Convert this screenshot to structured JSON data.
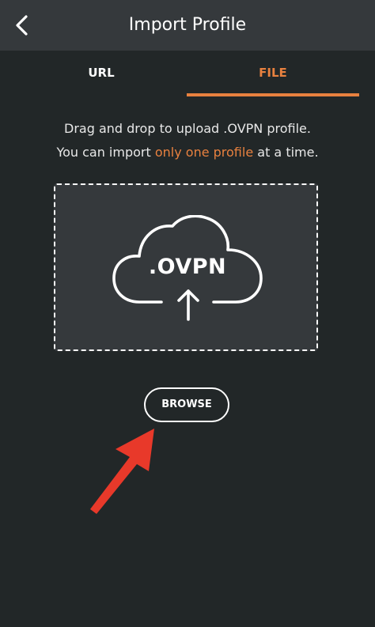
{
  "header": {
    "title": "Import Profile",
    "back_icon": "chevron-left-icon"
  },
  "tabs": [
    {
      "label": "URL",
      "active": false
    },
    {
      "label": "FILE",
      "active": true
    }
  ],
  "instructions": {
    "line1": "Drag and drop to upload .OVPN profile.",
    "line2_before": "You can import ",
    "line2_highlight": "only one profile",
    "line2_after": " at a time."
  },
  "dropzone": {
    "label": ".OVPN",
    "icon": "cloud-upload-icon"
  },
  "browse_button": {
    "label": "BROWSE"
  },
  "colors": {
    "accent": "#e8813f",
    "header_bg": "#35393c",
    "page_bg": "#222728",
    "annotation_arrow": "#e8392a"
  }
}
